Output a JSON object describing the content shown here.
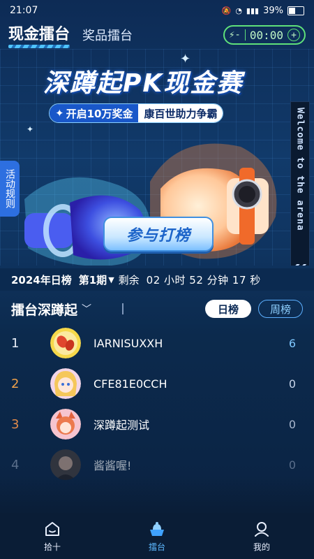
{
  "status": {
    "time": "21:07",
    "battery": "39%"
  },
  "header": {
    "active_tab": "现金擂台",
    "inactive_tab": "奖品擂台",
    "timer": "00:00"
  },
  "hero": {
    "title": "深蹲起PK现金赛",
    "subtitle_a": "开启10万奖金",
    "subtitle_b": "康百世助力争霸",
    "rules_label": "活动规则",
    "welcome_text": "Welcome to the arena",
    "join_button": "参与打榜"
  },
  "period": {
    "label": "2024年日榜",
    "issue": "第1期",
    "remain_label": "剩余",
    "countdown": "02 小时 52 分钟 17 秒"
  },
  "board": {
    "title": "擂台深蹲起",
    "toggle_day": "日榜",
    "toggle_week": "周榜"
  },
  "ranking": [
    {
      "rank": "1",
      "name": "IARNISUXXH",
      "score": "6",
      "rank_color": "#e9eef8",
      "score_color": "#7fc8ff",
      "avatar": "peanut"
    },
    {
      "rank": "2",
      "name": "CFE81E0CCH",
      "score": "0",
      "rank_color": "#f0a14a",
      "score_color": "#c9d6ea",
      "avatar": "girl"
    },
    {
      "rank": "3",
      "name": "深蹲起测试",
      "score": "0",
      "rank_color": "#e08a4a",
      "score_color": "#aab8cf",
      "avatar": "fox"
    },
    {
      "rank": "4",
      "name": "酱酱喔!",
      "score": "0",
      "rank_color": "#8fa0ba",
      "score_color": "#8fa0ba",
      "avatar": "photo"
    }
  ],
  "nav": [
    {
      "label": "拾十",
      "icon": "home-icon"
    },
    {
      "label": "擂台",
      "icon": "arena-icon"
    },
    {
      "label": "我的",
      "icon": "profile-icon"
    }
  ],
  "colors": {
    "accent": "#5db8ff",
    "green": "#5fe07a"
  }
}
